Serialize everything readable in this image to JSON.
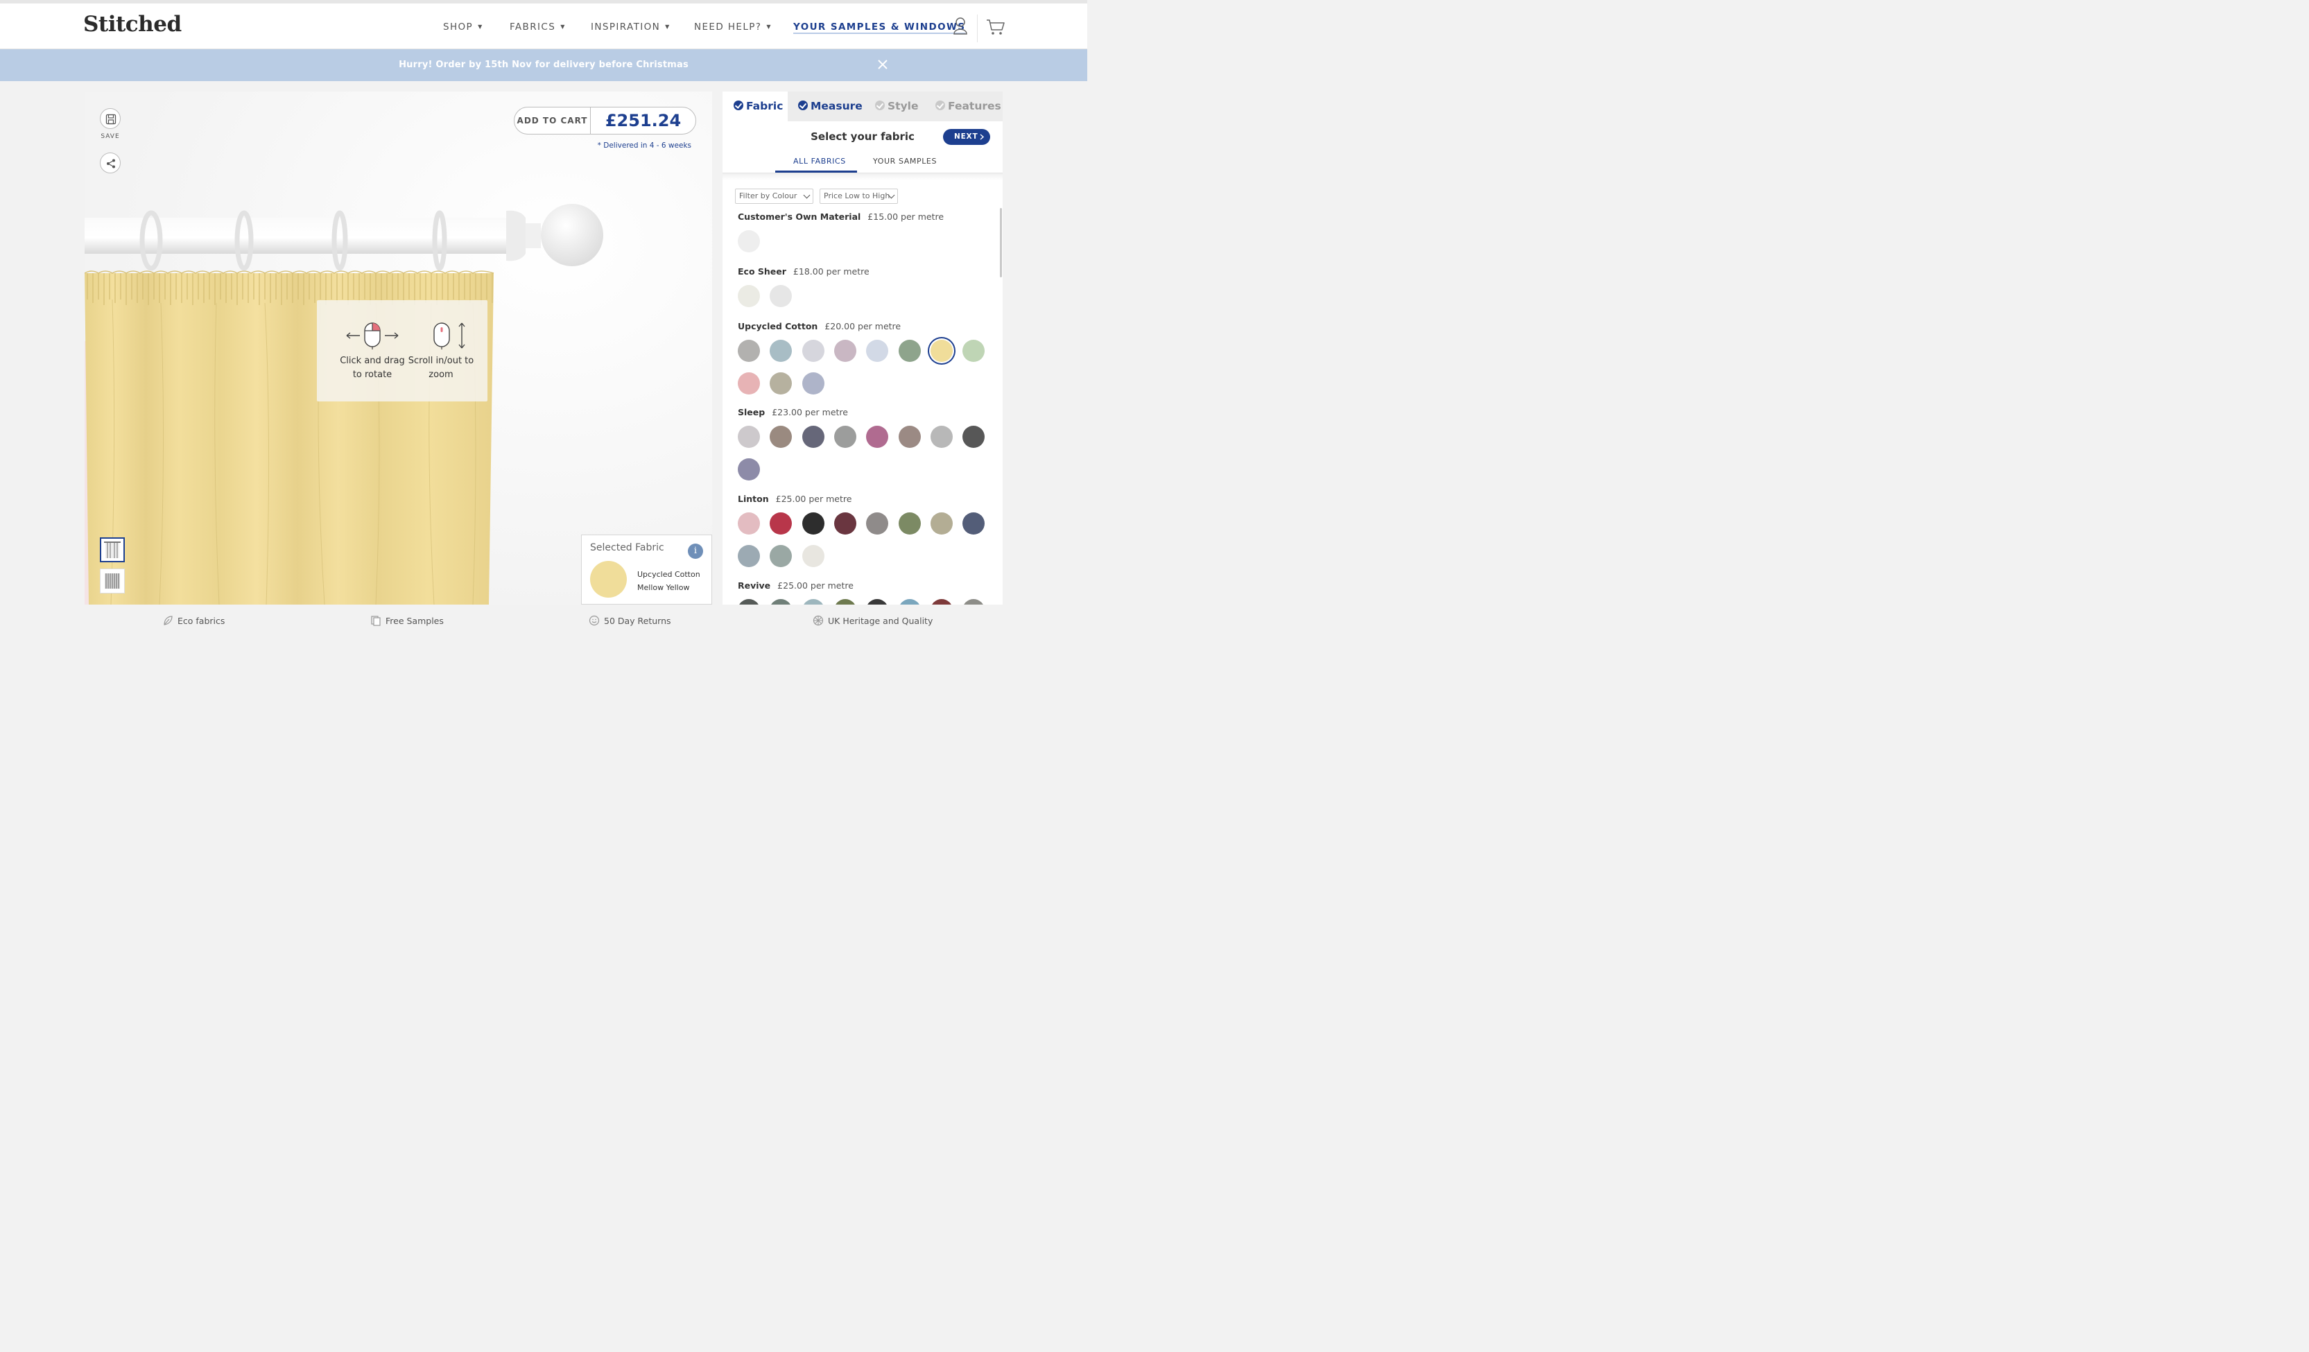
{
  "header": {
    "logo": "Stitched",
    "nav": [
      {
        "label": "SHOP"
      },
      {
        "label": "FABRICS"
      },
      {
        "label": "INSPIRATION"
      },
      {
        "label": "NEED HELP?"
      }
    ],
    "samples_link": "YOUR SAMPLES & WINDOWS",
    "icons": [
      "user-icon",
      "cart-icon"
    ]
  },
  "banner": {
    "text": "Hurry! Order by 15th Nov for delivery before Christmas",
    "close_icon": "close-icon",
    "color": "#b9cce4"
  },
  "viewer": {
    "save_label": "SAVE",
    "add_to_cart": "ADD TO CART",
    "price": "£251.24",
    "delivery_note": "* Delivered in 4 - 6 weeks",
    "hint_rotate": "Click and drag to rotate",
    "hint_zoom": "Scroll in/out to zoom",
    "curtain_color": "#f0dd9a",
    "selected_fabric": {
      "title": "Selected Fabric",
      "info_icon": "i",
      "fabric": "Upcycled Cotton",
      "colour": "Mellow Yellow",
      "swatch": "#f0dd9a"
    }
  },
  "panel": {
    "tabs": [
      {
        "label": "Fabric",
        "state": "done"
      },
      {
        "label": "Measure",
        "state": "done"
      },
      {
        "label": "Style",
        "state": "todo"
      },
      {
        "label": "Features",
        "state": "todo"
      }
    ],
    "title": "Select your fabric",
    "next_label": "NEXT",
    "subtabs": [
      {
        "label": "ALL FABRICS"
      },
      {
        "label": "YOUR SAMPLES"
      }
    ],
    "filter_colour": "Filter by Colour",
    "sort": "Price Low to High",
    "groups": [
      {
        "name": "Customer's Own Material",
        "price": "£15.00 per metre",
        "swatches": [
          "#eeeeee"
        ]
      },
      {
        "name": "Eco Sheer",
        "price": "£18.00 per metre",
        "swatches": [
          "#ebebe4",
          "#e6e6e6"
        ]
      },
      {
        "name": "Upcycled Cotton",
        "price": "£20.00 per metre",
        "swatches": [
          "#b2b1af",
          "#a8bdc5",
          "#d6d6dd",
          "#c9b7c3",
          "#d2d9e6",
          "#8ea48c",
          "#f0dd9a",
          "#bfd5b5",
          "#e7b3b5",
          "#b6b19f",
          "#aeb4c9"
        ],
        "selected": 6
      },
      {
        "name": "Sleep",
        "price": "£23.00 per metre",
        "swatches": [
          "#cdc9cc",
          "#9a8a80",
          "#666779",
          "#9c9d9c",
          "#b06b90",
          "#9b8a84",
          "#b8b8b8",
          "#575757",
          "#8d8ba8"
        ]
      },
      {
        "name": "Linton",
        "price": "£25.00 per metre",
        "swatches": [
          "#e3bcc1",
          "#b8364a",
          "#2d2d2d",
          "#6a3640",
          "#8f8b8a",
          "#7c8a64",
          "#b3ad94",
          "#535d78",
          "#9caab3",
          "#9aa8a4",
          "#e8e6e0"
        ]
      },
      {
        "name": "Revive",
        "price": "£25.00 per metre",
        "swatches": [
          "#555a57",
          "#6f7f78",
          "#9db6bd",
          "#6e7a4f",
          "#383838",
          "#7aa6bd",
          "#7e3a3a",
          "#8d8d88"
        ]
      }
    ]
  },
  "footer": [
    {
      "label": "Eco fabrics",
      "icon": "leaf-icon"
    },
    {
      "label": "Free Samples",
      "icon": "samples-icon"
    },
    {
      "label": "50 Day Returns",
      "icon": "smile-icon"
    },
    {
      "label": "UK Heritage and Quality",
      "icon": "flag-icon"
    }
  ]
}
